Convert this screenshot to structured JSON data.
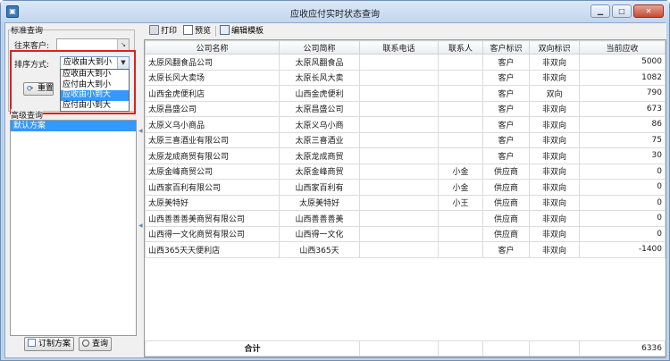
{
  "window": {
    "title": "应收应付实时状态查询",
    "icon_name": "app-logo-icon",
    "controls": [
      "minimize-icon",
      "maximize-icon",
      "close-icon"
    ]
  },
  "left_panel": {
    "group_title": "标准查询",
    "customer_label": "往来客户:",
    "customer_value": "",
    "sort_label": "排序方式:",
    "sort_selected": "应收由大到小",
    "sort_options": [
      "应收由大到小",
      "应付由大到小",
      "应收由小到大",
      "应付由小到大"
    ],
    "sort_highlight_index": 2,
    "reset_label": "重置",
    "advanced_title": "高级查询",
    "schemes": [
      "默认方案"
    ],
    "custom_button": "订制方案",
    "query_button": "查询"
  },
  "toolbar": {
    "print": "打印",
    "preview": "预览",
    "edit_template": "编辑模板"
  },
  "grid": {
    "columns": [
      "公司名称",
      "公司简称",
      "联系电话",
      "联系人",
      "客户标识",
      "双向标识",
      "当前应收"
    ],
    "rows": [
      [
        "太原风翻食品公司",
        "太原风翻食品",
        "",
        "",
        "客户",
        "非双向",
        "5000"
      ],
      [
        "太原长风大卖场",
        "太原长风大卖",
        "",
        "",
        "客户",
        "非双向",
        "1082"
      ],
      [
        "山西金虎便利店",
        "山西金虎便利",
        "",
        "",
        "客户",
        "双向",
        "790"
      ],
      [
        "太原昌盛公司",
        "太原昌盛公司",
        "",
        "",
        "客户",
        "非双向",
        "673"
      ],
      [
        "太原义乌小商品",
        "太原义乌小商",
        "",
        "",
        "客户",
        "非双向",
        "86"
      ],
      [
        "太原三喜酒业有限公司",
        "太原三喜酒业",
        "",
        "",
        "客户",
        "非双向",
        "75"
      ],
      [
        "太原龙成商贸有限公司",
        "太原龙成商贸",
        "",
        "",
        "客户",
        "非双向",
        "30"
      ],
      [
        "太原金峰商贸公司",
        "太原金峰商贸",
        "",
        "小金",
        "供应商",
        "非双向",
        "0"
      ],
      [
        "山西家百利有限公司",
        "山西家百利有",
        "",
        "小金",
        "供应商",
        "非双向",
        "0"
      ],
      [
        "太原美特好",
        "太原美特好",
        "",
        "小王",
        "供应商",
        "非双向",
        "0"
      ],
      [
        "山西善善善美商贸有限公司",
        "山西善善善美",
        "",
        "",
        "供应商",
        "非双向",
        "0"
      ],
      [
        "山西得一文化商贸有限公司",
        "山西得一文化",
        "",
        "",
        "供应商",
        "非双向",
        "0"
      ],
      [
        "山西365天天便利店",
        "山西365天",
        "",
        "",
        "客户",
        "非双向",
        "-1400"
      ]
    ],
    "total_label": "合计",
    "total_value": "6336"
  },
  "colors": {
    "highlight_border": "#e0201b",
    "selection": "#3399ff"
  }
}
